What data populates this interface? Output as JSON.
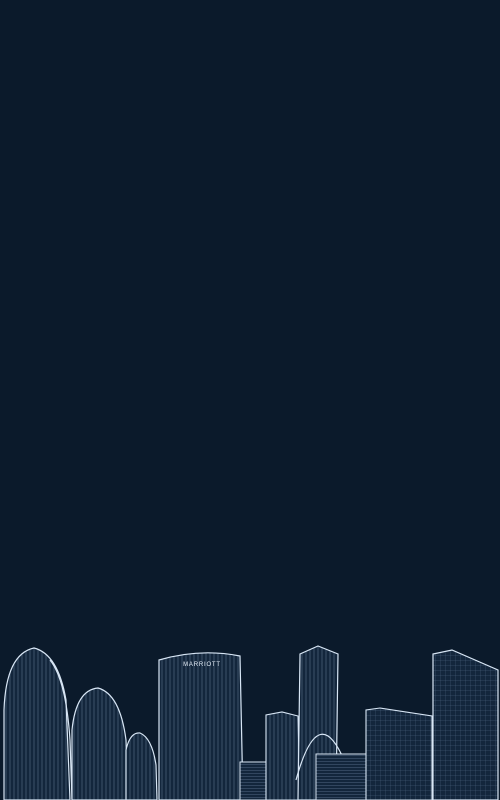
{
  "screen": {
    "background_color": "#0b1a2b",
    "illustration": "city-skyline-wireframe",
    "line_color": "#cfe0f5",
    "building_fill": "#122338"
  },
  "skyline": {
    "sign_text": "MARRIOTT"
  }
}
